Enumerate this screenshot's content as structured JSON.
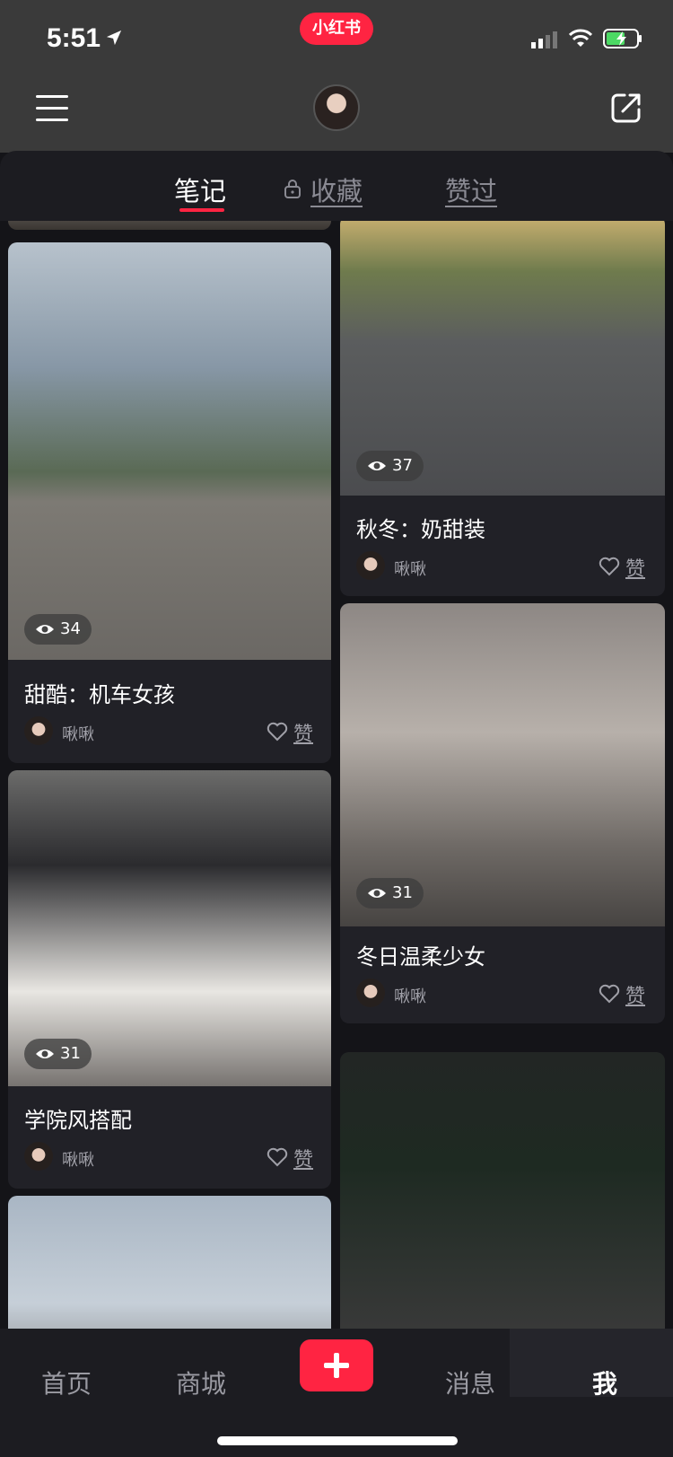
{
  "status": {
    "time": "5:51",
    "app_badge": "小红书"
  },
  "tabs": [
    {
      "label": "笔记"
    },
    {
      "label": "收藏"
    },
    {
      "label": "赞过"
    }
  ],
  "cards": [
    {
      "title": "甜酷：机车女孩",
      "views": "34",
      "author": "啾啾",
      "like_label": "赞"
    },
    {
      "title": "学院风搭配",
      "views": "31",
      "author": "啾啾",
      "like_label": "赞"
    },
    {
      "title": "秋冬：奶甜装",
      "views": "37",
      "author": "啾啾",
      "like_label": "赞"
    },
    {
      "title": "冬日温柔少女",
      "views": "31",
      "author": "啾啾",
      "like_label": "赞"
    }
  ],
  "nav": {
    "home": "首页",
    "shop": "商城",
    "messages": "消息",
    "me": "我"
  },
  "colors": {
    "accent": "#ff2442",
    "background": "#141418",
    "card": "#212127"
  }
}
